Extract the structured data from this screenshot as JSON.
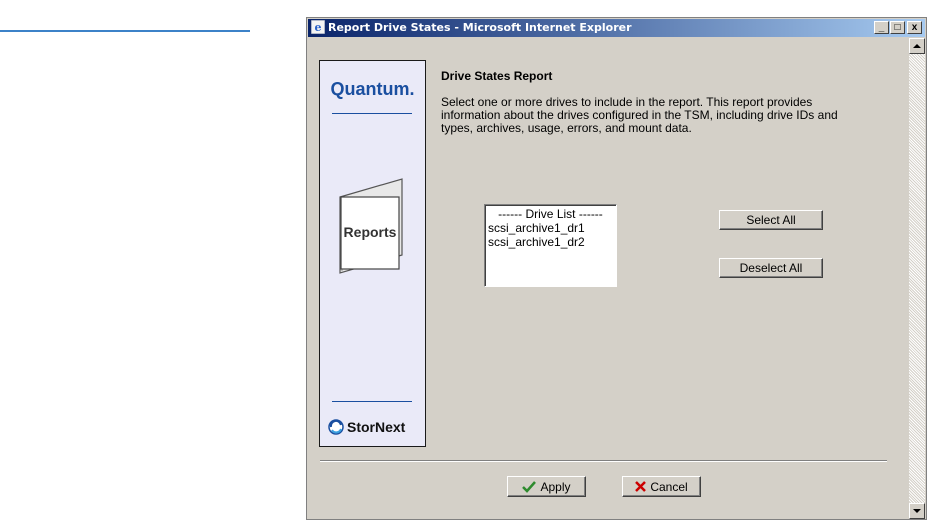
{
  "window": {
    "title": "Report Drive States - Microsoft Internet Explorer",
    "minimize_glyph": "_",
    "maximize_glyph": "□",
    "close_glyph": "x"
  },
  "sidebar": {
    "brand": "Quantum.",
    "book_label": "Reports",
    "footer_brand": "StorNext"
  },
  "report": {
    "title": "Drive States Report",
    "description": "Select one or more drives to include in the report. This report provides information about the drives configured in the TSM, including drive IDs and types, archives, usage, errors, and mount data."
  },
  "drive_list": {
    "header": "------ Drive List ------",
    "items": [
      "scsi_archive1_dr1",
      "scsi_archive1_dr2"
    ]
  },
  "buttons": {
    "select_all": "Select All",
    "deselect_all": "Deselect All",
    "apply": "Apply",
    "cancel": "Cancel"
  },
  "colors": {
    "title_bar": "#0a246a",
    "panel_bg": "#d4d0c8",
    "brand_blue": "#1a4fa0",
    "apply_check": "#2e8b2e",
    "cancel_x": "#cc0000"
  },
  "icons": [
    "ie-icon",
    "reports-book-icon",
    "stornext-logo-icon",
    "checkmark-icon",
    "x-icon"
  ]
}
